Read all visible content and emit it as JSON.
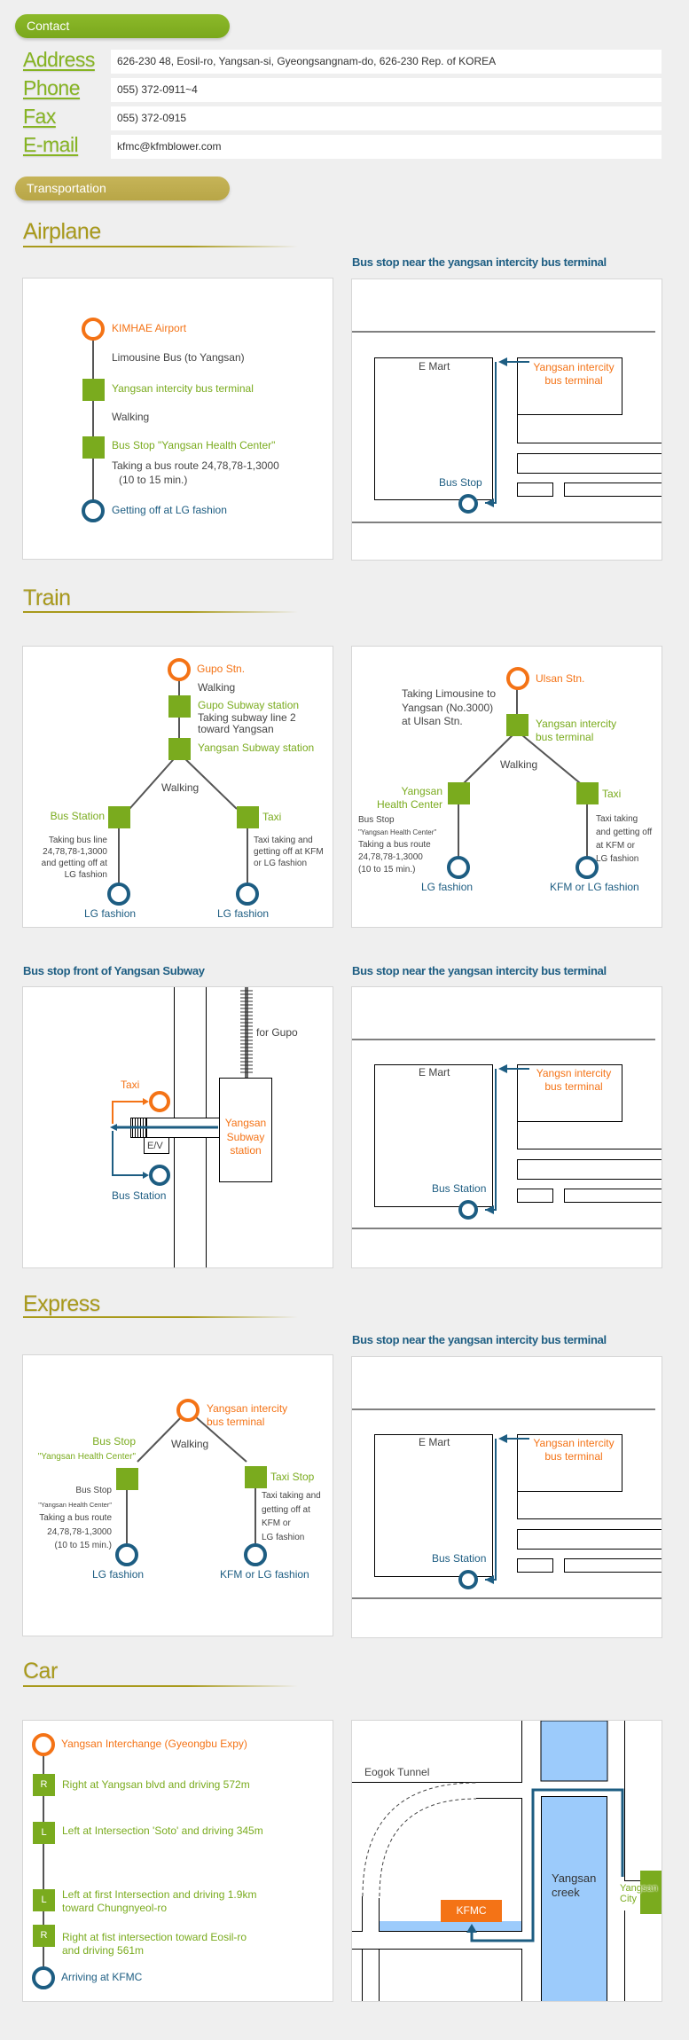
{
  "contact": {
    "heading": "Contact",
    "rows": [
      {
        "label": "Address",
        "value": "626-230 48, Eosil-ro, Yangsan-si, Gyeongsangnam-do, 626-230 Rep. of KOREA"
      },
      {
        "label": "Phone",
        "value": "055) 372-0911~4"
      },
      {
        "label": "Fax",
        "value": "055) 372-0915"
      },
      {
        "label": "E-mail",
        "value": "kfmc@kfmblower.com"
      }
    ]
  },
  "transportation": {
    "heading": "Transportation"
  },
  "airplane": {
    "title": "Airplane",
    "route": {
      "start": "KIMHAE Airport",
      "step1": "Limousine Bus (to Yangsan)",
      "stop1": "Yangsan intercity bus terminal",
      "step2": "Walking",
      "stop2": "Bus Stop \"Yangsan Health Center\"",
      "step3_line1": "Taking a bus route 24,78,78-1,3000",
      "step3_line2": "(10 to 15 min.)",
      "end": "Getting off at LG fashion"
    },
    "map": {
      "title": "Bus stop near the yangsan intercity bus  terminal",
      "emart": "E Mart",
      "terminal_line1": "Yangsan intercity",
      "terminal_line2": "bus terminal",
      "stop": "Bus Stop"
    }
  },
  "train": {
    "title": "Train",
    "gupo": {
      "start": "Gupo Stn.",
      "walk1": "Walking",
      "stop1": "Gupo Subway station",
      "step_line1": "Taking subway line 2",
      "step_line2": "toward Yangsan",
      "stop2": "Yangsan Subway station",
      "walk2": "Walking",
      "bus_label": "Bus Station",
      "bus_desc": [
        "Taking bus line",
        "24,78,78-1,3000",
        "and getting off at",
        "LG fashion"
      ],
      "bus_end": "LG fashion",
      "taxi_label": "Taxi",
      "taxi_desc": [
        "Taxi taking and",
        "getting off at KFM",
        "or LG fashion"
      ],
      "taxi_end": "LG fashion"
    },
    "ulsan": {
      "start": "Ulsan  Stn.",
      "limo": [
        "Taking Limousine to",
        "Yangsan (No.3000)",
        "at Ulsan  Stn."
      ],
      "stop1_line1": "Yangsan intercity",
      "stop1_line2": "bus terminal",
      "walk": "Walking",
      "bus_label_line1": "Yangsan",
      "bus_label_line2": "Health Center",
      "bus_desc": [
        "Bus Stop",
        "\"Yangsan Health Center\"",
        "Taking a bus route",
        "24,78,78-1,3000",
        "(10 to 15 min.)"
      ],
      "bus_end": "LG fashion",
      "taxi_label": "Taxi",
      "taxi_desc": [
        "Taxi taking",
        "and getting off",
        "at KFM or",
        "LG fashion"
      ],
      "taxi_end": "KFM or LG fashion"
    },
    "subway_map": {
      "title": "Bus stop front of Yangsan Subway",
      "for_gupo": "for Gupo",
      "taxi": "Taxi",
      "ev": "E/V",
      "station_line1": "Yangsan",
      "station_line2": "Subway",
      "station_line3": "station",
      "bus_station": "Bus Station"
    },
    "terminal_map": {
      "title": "Bus stop near the yangsan intercity bus  terminal",
      "emart": "E Mart",
      "terminal_line1": "Yangsn intercity",
      "terminal_line2": "bus terminal",
      "stop": "Bus Station"
    }
  },
  "express": {
    "title": "Express",
    "route": {
      "start_line1": "Yangsan intercity",
      "start_line2": "bus terminal",
      "walk": "Walking",
      "bus_label_line1": "Bus Stop",
      "bus_label_line2": "\"Yangsan Health Center\"",
      "bus_desc": [
        "Bus Stop",
        "\"Yangsan Health Center\"",
        "Taking a bus route",
        "24,78,78-1,3000",
        "(10 to 15 min.)"
      ],
      "bus_end": "LG fashion",
      "taxi_label": "Taxi Stop",
      "taxi_desc": [
        "Taxi taking and",
        "getting off at",
        "KFM or",
        "LG fashion"
      ],
      "taxi_end": "KFM or LG fashion"
    },
    "map": {
      "title": "Bus stop near the yangsan intercity bus  terminal",
      "emart": "E Mart",
      "terminal_line1": "Yangsan intercity",
      "terminal_line2": "bus terminal",
      "stop": "Bus Station"
    }
  },
  "car": {
    "title": "Car",
    "route": {
      "start": "Yangsan Interchange (Gyeongbu Expy)",
      "steps": [
        {
          "badge": "R",
          "line1": "Right at Yangsan blvd and driving 572m",
          "line2": ""
        },
        {
          "badge": "L",
          "line1": "Left at Intersection 'Soto' and driving 345m",
          "line2": ""
        },
        {
          "badge": "L",
          "line1": "Left at first Intersection and driving 1.9km",
          "line2": "toward Chungnyeol-ro"
        },
        {
          "badge": "R",
          "line1": "Right at fist intersection toward Eosil-ro",
          "line2": "and driving 561m"
        }
      ],
      "end": "Arriving at KFMC"
    },
    "map": {
      "tunnel": "Eogok Tunnel",
      "kfmc": "KFMC",
      "creek_line1": "Yangsan",
      "creek_line2": "creek",
      "city_line1": "Yangsan",
      "city_line2": "City"
    }
  },
  "colors": {
    "green": "#7aab1e",
    "orange": "#f47316",
    "blue": "#1d5d82",
    "olive": "#a99a1c",
    "water": "#9ccbfb"
  }
}
